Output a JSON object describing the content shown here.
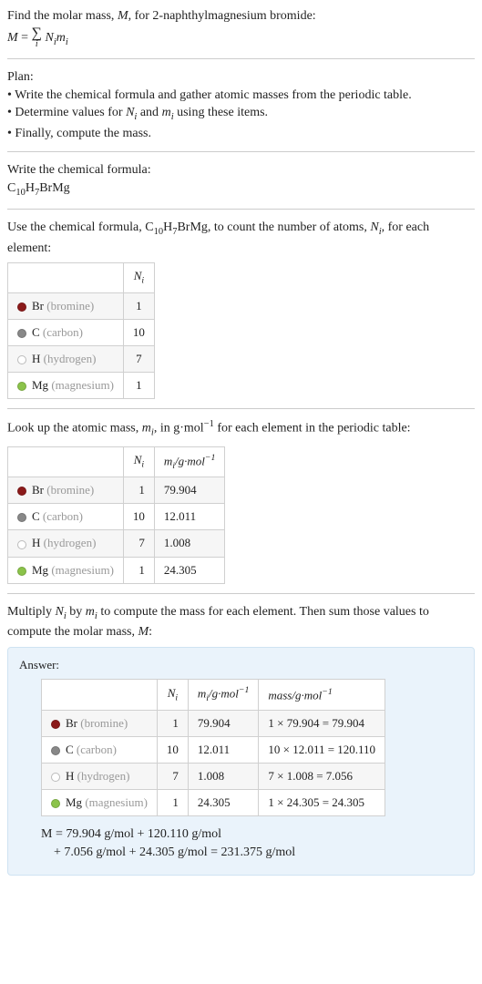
{
  "intro": {
    "line1_a": "Find the molar mass, ",
    "line1_b": ", for 2-naphthylmagnesium bromide:",
    "formula_lhs": "M",
    "formula_eq": " = ",
    "sum_sym": "∑",
    "sum_idx": "i",
    "sum_body_a": "N",
    "sum_body_b": "m"
  },
  "plan": {
    "heading": "Plan:",
    "b1": "• Write the chemical formula and gather atomic masses from the periodic table.",
    "b2_a": "• Determine values for ",
    "b2_b": " and ",
    "b2_c": " using these items.",
    "b3": "• Finally, compute the mass."
  },
  "chemformula": {
    "heading": "Write the chemical formula:",
    "c10": "C",
    "n10": "10",
    "h": "H",
    "n7": "7",
    "tail": "BrMg"
  },
  "count": {
    "line_a": "Use the chemical formula, ",
    "line_b": ", to count the number of atoms, ",
    "line_c": ", for each element:",
    "hdr_n": "N",
    "rows": [
      {
        "sym": "Br",
        "name": "(bromine)",
        "dot": "dot-br",
        "n": "1"
      },
      {
        "sym": "C",
        "name": "(carbon)",
        "dot": "dot-c",
        "n": "10"
      },
      {
        "sym": "H",
        "name": "(hydrogen)",
        "dot": "dot-h",
        "n": "7"
      },
      {
        "sym": "Mg",
        "name": "(magnesium)",
        "dot": "dot-mg",
        "n": "1"
      }
    ]
  },
  "masses": {
    "line_a": "Look up the atomic mass, ",
    "line_b": ", in g·mol",
    "line_c": " for each element in the periodic table:",
    "hdr_n": "N",
    "hdr_m": "m",
    "hdr_unit": "/g·mol",
    "rows": [
      {
        "sym": "Br",
        "name": "(bromine)",
        "dot": "dot-br",
        "n": "1",
        "m": "79.904"
      },
      {
        "sym": "C",
        "name": "(carbon)",
        "dot": "dot-c",
        "n": "10",
        "m": "12.011"
      },
      {
        "sym": "H",
        "name": "(hydrogen)",
        "dot": "dot-h",
        "n": "7",
        "m": "1.008"
      },
      {
        "sym": "Mg",
        "name": "(magnesium)",
        "dot": "dot-mg",
        "n": "1",
        "m": "24.305"
      }
    ]
  },
  "multiply": {
    "line_a": "Multiply ",
    "line_b": " by ",
    "line_c": " to compute the mass for each element. Then sum those values to compute the molar mass, ",
    "line_d": ":"
  },
  "answer": {
    "label": "Answer:",
    "hdr_n": "N",
    "hdr_m": "m",
    "hdr_unit": "/g·mol",
    "hdr_mass": "mass/g·mol",
    "rows": [
      {
        "sym": "Br",
        "name": "(bromine)",
        "dot": "dot-br",
        "n": "1",
        "m": "79.904",
        "expr": "1 × 79.904 = 79.904"
      },
      {
        "sym": "C",
        "name": "(carbon)",
        "dot": "dot-c",
        "n": "10",
        "m": "12.011",
        "expr": "10 × 12.011 = 120.110"
      },
      {
        "sym": "H",
        "name": "(hydrogen)",
        "dot": "dot-h",
        "n": "7",
        "m": "1.008",
        "expr": "7 × 1.008 = 7.056"
      },
      {
        "sym": "Mg",
        "name": "(magnesium)",
        "dot": "dot-mg",
        "n": "1",
        "m": "24.305",
        "expr": "1 × 24.305 = 24.305"
      }
    ],
    "mline1": "M = 79.904 g/mol + 120.110 g/mol",
    "mline2": "+ 7.056 g/mol + 24.305 g/mol = 231.375 g/mol"
  },
  "sym": {
    "Ni_N": "N",
    "Ni_i": "i",
    "mi_m": "m",
    "mi_i": "i",
    "M": "M",
    "neg1": "−1"
  }
}
